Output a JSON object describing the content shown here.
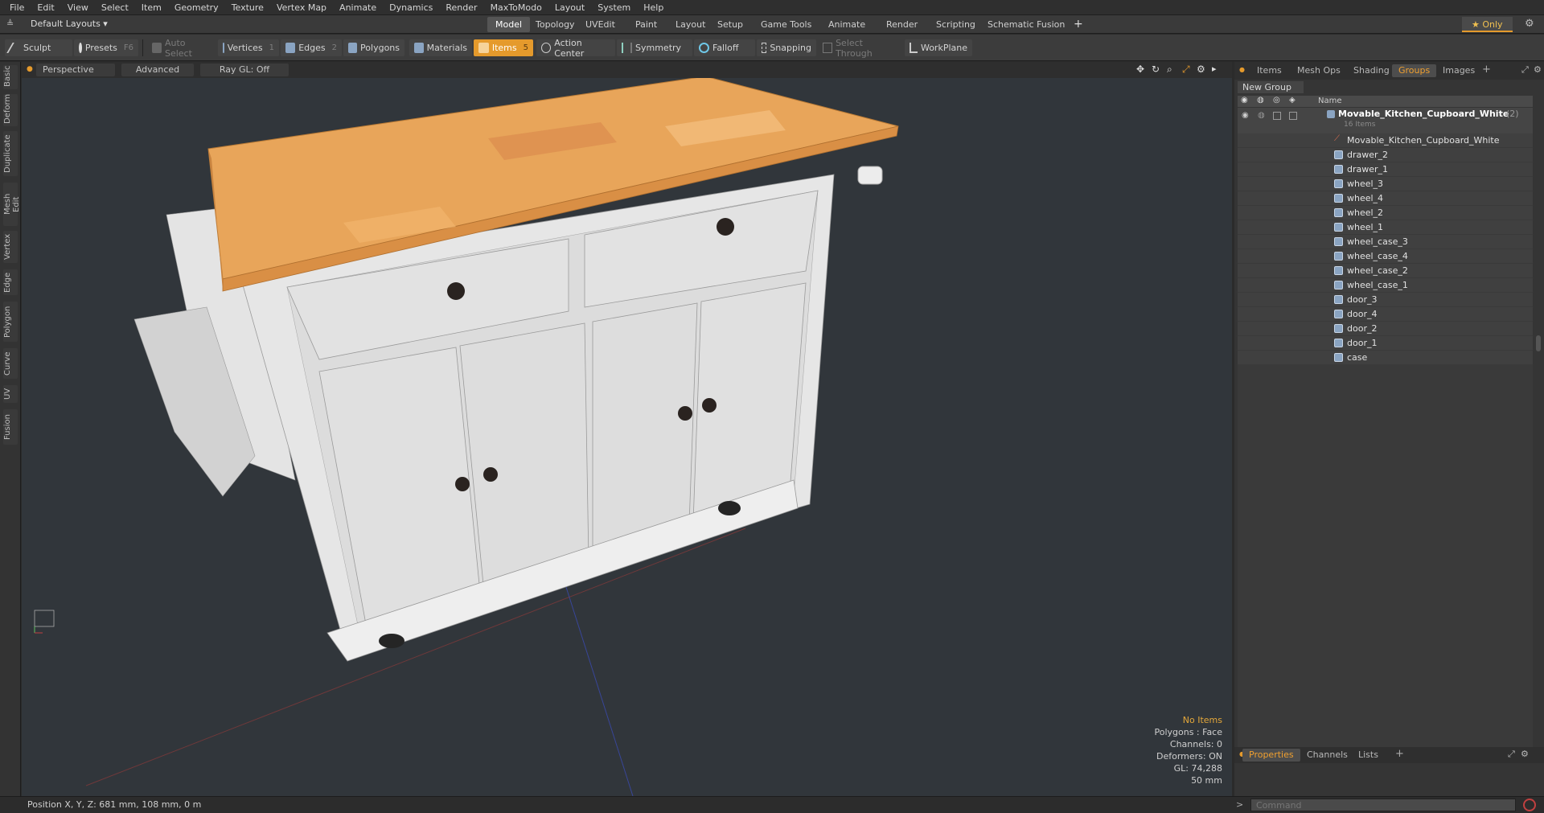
{
  "menu": [
    "File",
    "Edit",
    "View",
    "Select",
    "Item",
    "Geometry",
    "Texture",
    "Vertex Map",
    "Animate",
    "Dynamics",
    "Render",
    "MaxToModo",
    "Layout",
    "System",
    "Help"
  ],
  "layout": {
    "dropdown": "Default Layouts ▾",
    "tabs": [
      "Model",
      "Topology",
      "UVEdit",
      "Paint",
      "Layout",
      "Setup",
      "Game Tools",
      "Animate",
      "Render",
      "Scripting",
      "Schematic Fusion"
    ],
    "active_tab": "Model",
    "add": "+",
    "only": "★  Only"
  },
  "toolbar": {
    "sculpt": "Sculpt",
    "presets": "Presets",
    "presets_key": "F6",
    "auto_select": "Auto Select",
    "vertices": "Vertices",
    "vertices_key": "1",
    "edges": "Edges",
    "edges_key": "2",
    "polygons": "Polygons",
    "materials": "Materials",
    "items": "Items",
    "items_key": "5",
    "action_center": "Action Center",
    "symmetry": "Symmetry",
    "falloff": "Falloff",
    "snapping": "Snapping",
    "select_through": "Select Through",
    "workplane": "WorkPlane"
  },
  "left_tabs": [
    "Basic",
    "Deform",
    "Duplicate",
    "Mesh Edit",
    "Vertex",
    "Edge",
    "Polygon",
    "Curve",
    "UV",
    "Fusion"
  ],
  "viewport": {
    "view": "Perspective",
    "shading": "Advanced",
    "raygl": "Ray GL: Off",
    "info": {
      "selection": "No Items",
      "polygons": "Polygons : Face",
      "channels": "Channels: 0",
      "deformers": "Deformers: ON",
      "gl": "GL: 74,288",
      "scale": "50 mm"
    }
  },
  "right_panel": {
    "tabs": [
      "Items",
      "Mesh Ops",
      "Shading",
      "Groups",
      "Images"
    ],
    "active_tab": "Groups",
    "new_group": "New Group",
    "name_header": "Name",
    "group_name": "Movable_Kitchen_Cupboard_White",
    "group_count": "(2)",
    "group_sub": "16 Items",
    "items": [
      "Movable_Kitchen_Cupboard_White",
      "drawer_2",
      "drawer_1",
      "wheel_3",
      "wheel_4",
      "wheel_2",
      "wheel_1",
      "wheel_case_3",
      "wheel_case_4",
      "wheel_case_2",
      "wheel_case_1",
      "door_3",
      "door_4",
      "door_2",
      "door_1",
      "case"
    ],
    "bottom_tabs": [
      "Properties",
      "Channels",
      "Lists"
    ],
    "bottom_active": "Properties",
    "command_placeholder": "Command"
  },
  "status": {
    "position": "Position X, Y, Z:   681 mm, 108 mm, 0 m"
  },
  "colors": {
    "accent": "#e59a2c",
    "countertop": "#e8a55a",
    "cabinet": "#dedede"
  }
}
